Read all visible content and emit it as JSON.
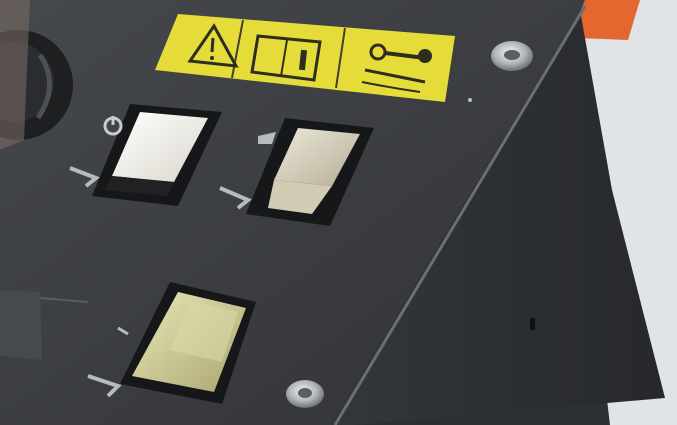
{
  "scene": {
    "description_label": "",
    "colors": {
      "background_right": "#dfe4e6",
      "orange_panel": "#e4672f",
      "panel_face": "#3a3c40",
      "panel_side": "#2f3134",
      "panel_edge_highlight": "#5c6064",
      "label_yellow": "#e5dc3a",
      "label_line": "#3f3f2b",
      "switch_housing": "#151719",
      "switch_white": "#f2efe4",
      "switch_cream": "#cdc6ad",
      "button_yellow": "#d7d69d",
      "screw": "#b9bcc0"
    },
    "icons": {
      "warning_triangle": "warning-triangle-icon",
      "manual_book": "manual-book-icon",
      "key": "key-icon",
      "power": "power-icon"
    }
  }
}
